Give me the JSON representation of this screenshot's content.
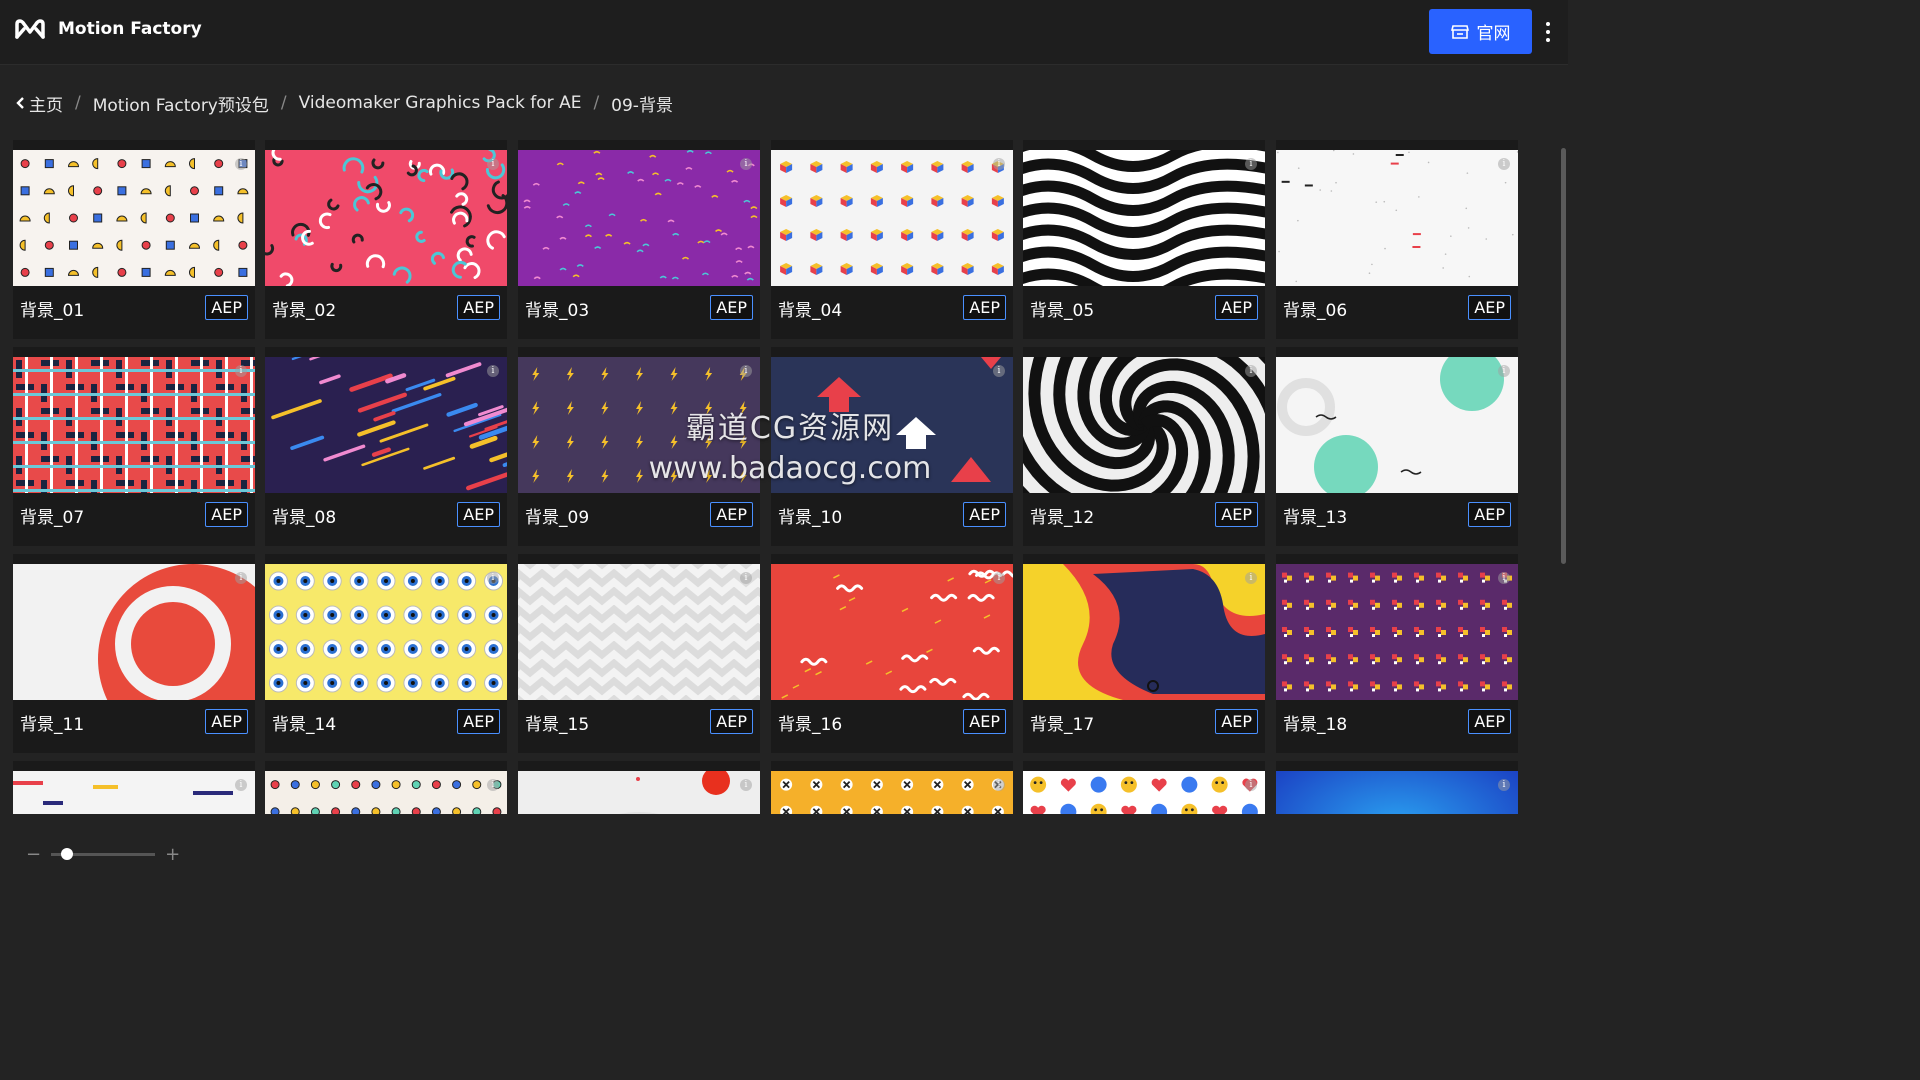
{
  "app": {
    "title": "Motion Factory",
    "site_button_label": "官网"
  },
  "breadcrumb": {
    "items": [
      "主页",
      "Motion Factory预设包",
      "Videomaker Graphics Pack for AE",
      "09-背景"
    ],
    "separator": "/"
  },
  "watermark": {
    "line1": "霸道CG资源网",
    "line2": "www.badaocg.com"
  },
  "grid": {
    "badge_label": "AEP",
    "info_glyph": "i",
    "cards": [
      {
        "title": "背景_01"
      },
      {
        "title": "背景_02"
      },
      {
        "title": "背景_03"
      },
      {
        "title": "背景_04"
      },
      {
        "title": "背景_05"
      },
      {
        "title": "背景_06"
      },
      {
        "title": "背景_07"
      },
      {
        "title": "背景_08"
      },
      {
        "title": "背景_09"
      },
      {
        "title": "背景_10"
      },
      {
        "title": "背景_12"
      },
      {
        "title": "背景_13"
      },
      {
        "title": "背景_11"
      },
      {
        "title": "背景_14"
      },
      {
        "title": "背景_15"
      },
      {
        "title": "背景_16"
      },
      {
        "title": "背景_17"
      },
      {
        "title": "背景_18"
      },
      {
        "title": ""
      },
      {
        "title": ""
      },
      {
        "title": ""
      },
      {
        "title": ""
      },
      {
        "title": ""
      },
      {
        "title": ""
      }
    ]
  },
  "zoom": {
    "minus": "−",
    "plus": "+",
    "level": 0.1
  },
  "colors": {
    "accent": "#2962ff",
    "badge_border": "#4a90ff"
  }
}
